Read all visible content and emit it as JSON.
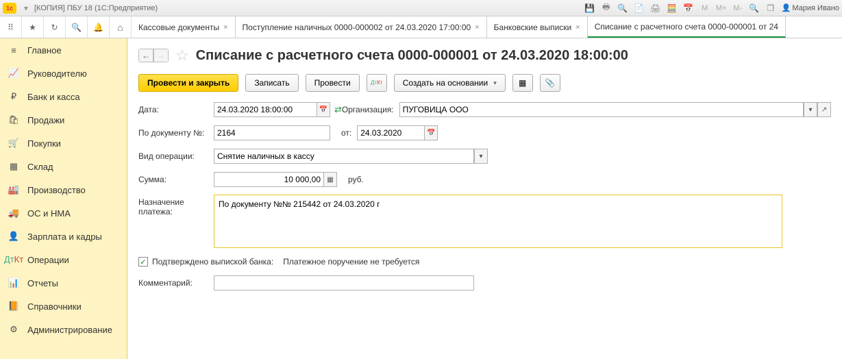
{
  "titlebar": {
    "title": "[КОПИЯ] ПБУ 18  (1С:Предприятие)",
    "m_labels": [
      "M",
      "M+",
      "M-"
    ],
    "user": "Мария Ивано"
  },
  "tabs": [
    {
      "label": "Кассовые документы"
    },
    {
      "label": "Поступление наличных 0000-000002 от 24.03.2020 17:00:00"
    },
    {
      "label": "Банковские выписки"
    },
    {
      "label": "Списание с расчетного счета 0000-000001 от 24"
    }
  ],
  "sidebar": {
    "items": [
      {
        "label": "Главное",
        "icon": "≡"
      },
      {
        "label": "Руководителю",
        "icon": "chart"
      },
      {
        "label": "Банк и касса",
        "icon": "ruble"
      },
      {
        "label": "Продажи",
        "icon": "cart"
      },
      {
        "label": "Покупки",
        "icon": "cart2"
      },
      {
        "label": "Склад",
        "icon": "boxes"
      },
      {
        "label": "Производство",
        "icon": "factory"
      },
      {
        "label": "ОС и НМА",
        "icon": "truck"
      },
      {
        "label": "Зарплата и кадры",
        "icon": "person"
      },
      {
        "label": "Операции",
        "icon": "dtkt"
      },
      {
        "label": "Отчеты",
        "icon": "bars"
      },
      {
        "label": "Справочники",
        "icon": "book"
      },
      {
        "label": "Администрирование",
        "icon": "gear"
      }
    ]
  },
  "page": {
    "title": "Списание с расчетного счета 0000-000001 от 24.03.2020 18:00:00"
  },
  "toolbar": {
    "post_close": "Провести и закрыть",
    "save": "Записать",
    "post": "Провести",
    "create_based": "Создать на основании"
  },
  "form": {
    "date_label": "Дата:",
    "date_value": "24.03.2020 18:00:00",
    "org_label": "Организация:",
    "org_value": "ПУГОВИЦА ООО",
    "doc_num_label": "По документу №:",
    "doc_num_value": "2164",
    "from_label": "от:",
    "from_value": "24.03.2020",
    "op_type_label": "Вид операции:",
    "op_type_value": "Снятие наличных в кассу",
    "sum_label": "Сумма:",
    "sum_value": "10 000,00",
    "currency": "руб.",
    "purpose_label": "Назначение платежа:",
    "purpose_value": "По документу №№ 215442 от 24.03.2020 г",
    "confirmed_label": "Подтверждено выпиской банка:",
    "pay_order_info": "Платежное поручение не требуется",
    "comment_label": "Комментарий:",
    "comment_value": ""
  }
}
